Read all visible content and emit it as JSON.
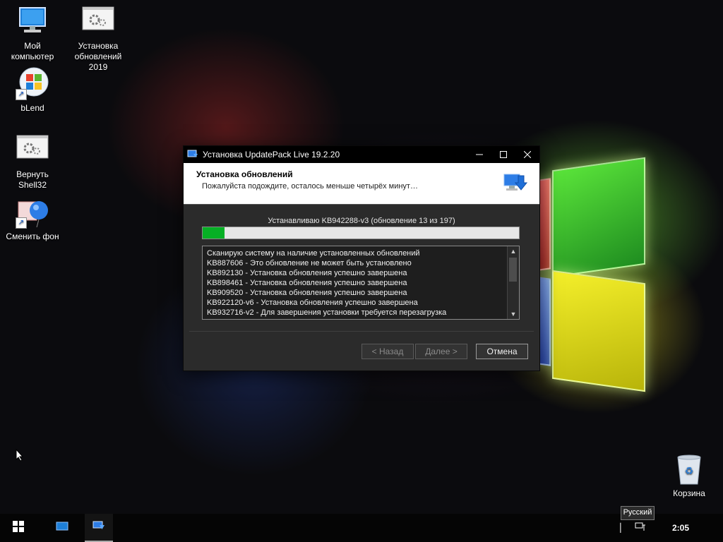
{
  "desktop": {
    "icons": [
      {
        "label": "Мой компьютер"
      },
      {
        "label": "Установка обновлений 2019"
      },
      {
        "label": "bLend"
      },
      {
        "label": "Вернуть Shell32"
      },
      {
        "label": "Сменить фон"
      },
      {
        "label": "Корзина"
      }
    ]
  },
  "dialog": {
    "title": "Установка UpdatePack Live 19.2.20",
    "header_title": "Установка обновлений",
    "header_subtitle": "Пожалуйста подождите, осталось меньше четырёх минут…",
    "status": "Устанавливаю KB942288-v3 (обновление 13 из 197)",
    "progress_fraction": 0.07,
    "log": [
      "Сканирую систему на наличие установленных обновлений",
      "KB887606 - Это обновление не может быть установлено",
      "KB892130 - Установка обновления успешно завершена",
      "KB898461 - Установка обновления успешно завершена",
      "KB909520 - Установка обновления успешно завершена",
      "KB922120-v6 - Установка обновления успешно завершена",
      "KB932716-v2 - Для завершения установки требуется перезагрузка"
    ],
    "buttons": {
      "back": "< Назад",
      "next": "Далее >",
      "cancel": "Отмена"
    }
  },
  "taskbar": {
    "language_tooltip": "Русский",
    "clock": "2:05"
  },
  "colors": {
    "progress": "#06b025",
    "dialog_bg": "#2b2b2b",
    "titlebar": "#000000"
  }
}
